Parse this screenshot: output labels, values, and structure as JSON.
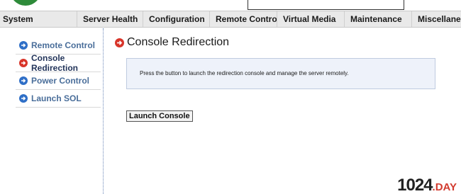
{
  "nav": {
    "items": [
      {
        "label": "System"
      },
      {
        "label": "Server Health"
      },
      {
        "label": "Configuration"
      },
      {
        "label": "Remote Control"
      },
      {
        "label": "Virtual Media"
      },
      {
        "label": "Maintenance"
      },
      {
        "label": "Miscellaneous"
      }
    ]
  },
  "sidebar": {
    "items": [
      {
        "label": "Remote Control",
        "icon": "arrow-right-circle-icon",
        "color": "#2f6fc7",
        "active": false
      },
      {
        "label": "Console Redirection",
        "icon": "arrow-right-circle-icon",
        "color": "#d8352a",
        "active": true
      },
      {
        "label": "Power Control",
        "icon": "arrow-right-circle-icon",
        "color": "#2f6fc7",
        "active": false
      },
      {
        "label": "Launch SOL",
        "icon": "arrow-right-circle-icon",
        "color": "#2f6fc7",
        "active": false
      }
    ]
  },
  "main": {
    "title": "Console Redirection",
    "description": "Press the button to launch the redirection console and manage the server remotely.",
    "launch_button": "Launch Console"
  },
  "watermark": {
    "main": "1024",
    "sub": ".DAY"
  },
  "colors": {
    "accent_blue": "#2f6fc7",
    "accent_red": "#d8352a",
    "info_box_bg": "#eef2fa"
  }
}
